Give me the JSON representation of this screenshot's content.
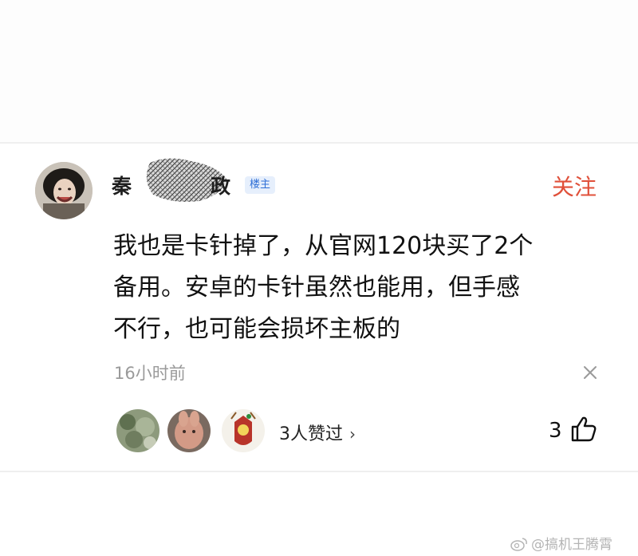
{
  "comment": {
    "author": {
      "name_first": "秦",
      "name_last": "政",
      "badge": "楼主",
      "avatar_icon": "user-avatar-icon"
    },
    "follow_label": "关注",
    "text_lines": [
      "我也是卡针掉了，从官网120块买了2个",
      "备用。安卓的卡针虽然也能用，但手感",
      "不行，也可能会损坏主板的"
    ],
    "timestamp": "16小时前",
    "likes": {
      "summary": "3人赞过",
      "count": "3"
    }
  },
  "watermark": {
    "text": "@搞机王腾霄"
  },
  "colors": {
    "accent": "#e0503a",
    "badge_text": "#2f6fd6",
    "badge_bg": "#e6effc",
    "muted": "#9a9a9a"
  }
}
